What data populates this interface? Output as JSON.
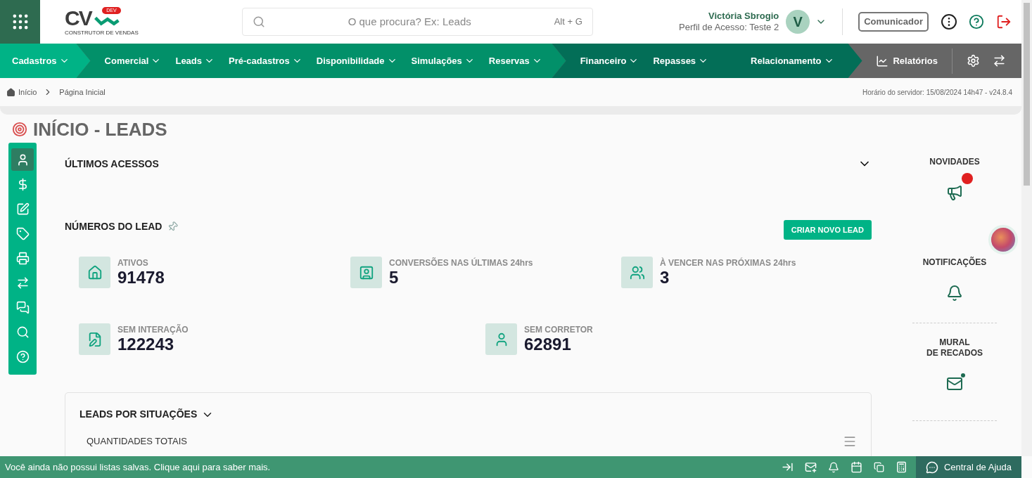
{
  "header": {
    "logo": {
      "letters": "CV",
      "badge": "DEV",
      "tagline": "CONSTRUTOR DE VENDAS"
    },
    "search": {
      "placeholder": "O que procura? Ex: Leads",
      "shortcut": "Alt + G"
    },
    "user": {
      "name": "Victória Sbrogio",
      "profile": "Perfil de Acesso: Teste 2",
      "initial": "V"
    },
    "communicator": "Comunicador"
  },
  "nav": {
    "groups": [
      {
        "kind": "light",
        "items": [
          "Cadastros"
        ]
      },
      {
        "kind": "mid",
        "items": [
          "Comercial",
          "Leads",
          "Pré-cadastros",
          "Disponibilidade",
          "Simulações",
          "Reservas"
        ]
      },
      {
        "kind": "dark",
        "items": [
          "Financeiro",
          "Repasses",
          "Relacionamento"
        ]
      }
    ],
    "reports": "Relatórios"
  },
  "breadcrumb": {
    "items": [
      "Início",
      "Página Inicial"
    ],
    "server_time": "Horário do servidor: 15/08/2024 14h47 - v24.8.4"
  },
  "page_title": "INÍCIO - LEADS",
  "sidebar": {
    "items": [
      {
        "selected": true
      },
      {
        "selected": false
      },
      {
        "selected": false
      },
      {
        "selected": false
      },
      {
        "selected": false
      },
      {
        "selected": false
      },
      {
        "selected": false
      },
      {
        "selected": false
      },
      {
        "selected": false
      }
    ]
  },
  "recent_access": {
    "title": "ÚLTIMOS ACESSOS",
    "expanded": false
  },
  "lead_numbers": {
    "title": "NÚMEROS DO LEAD",
    "create_button": "CRIAR NOVO LEAD",
    "rows": [
      [
        {
          "label": "ATIVOS",
          "value": "91478"
        },
        {
          "label": "CONVERSÕES NAS ÚLTIMAS 24hrs",
          "value": "5"
        },
        {
          "label": "À VENCER NAS PRÓXIMAS 24hrs",
          "value": "3"
        }
      ],
      [
        {
          "label": "SEM INTERAÇÃO",
          "value": "122243"
        },
        {
          "label": "SEM CORRETOR",
          "value": "62891"
        }
      ]
    ]
  },
  "leads_by_status": {
    "title": "LEADS POR SITUAÇÕES",
    "subtitle": "QUANTIDADES TOTAIS"
  },
  "right_panel": {
    "items": [
      {
        "title": "NOVIDADES",
        "unread": true
      },
      {
        "title": "NOTIFICAÇÕES",
        "unread": false
      },
      {
        "title": "MURAL\nDE RECADOS",
        "unread": true
      }
    ]
  },
  "status_bar": {
    "message": "Você ainda não possui listas salvas. Clique aqui para saber mais.",
    "help": "Central de Ajuda"
  }
}
